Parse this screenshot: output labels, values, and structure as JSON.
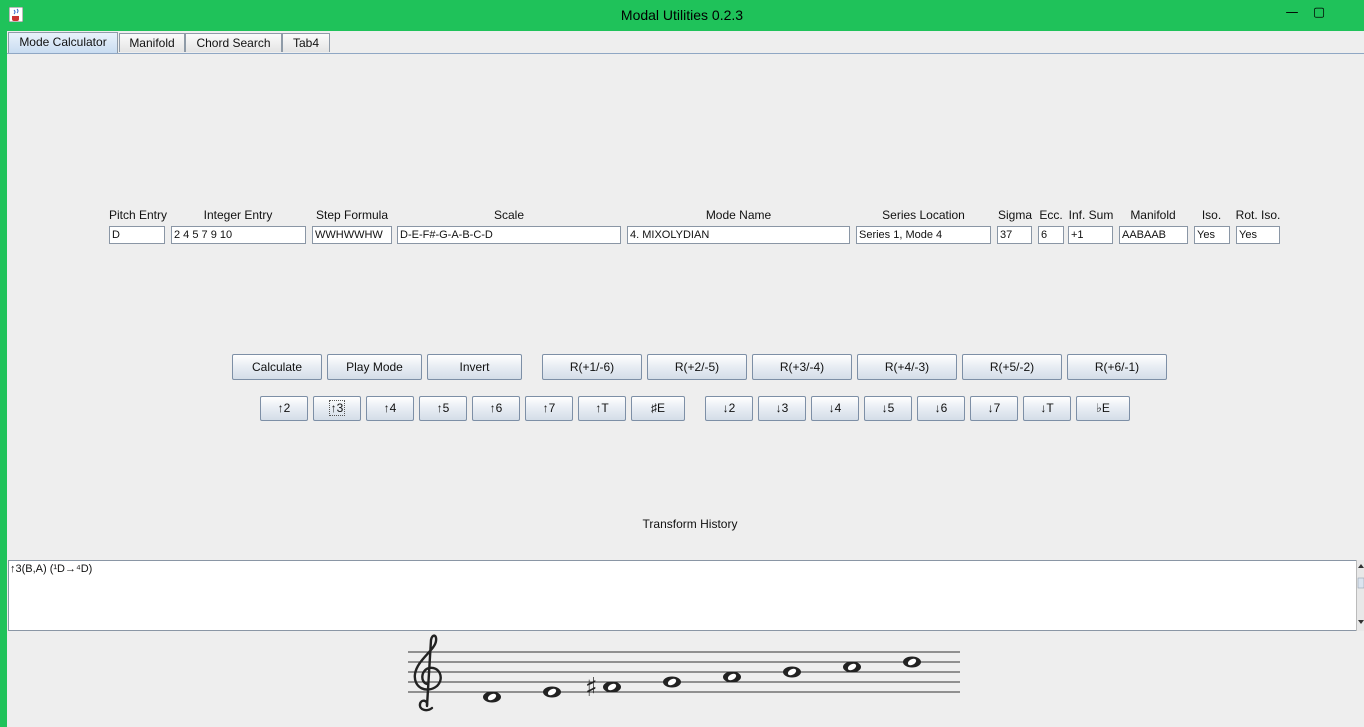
{
  "window": {
    "title": "Modal Utilities 0.2.3",
    "minimize": "—",
    "maximize": "▢"
  },
  "tabs": [
    "Mode Calculator",
    "Manifold",
    "Chord Search",
    "Tab4"
  ],
  "headers": {
    "pitch_entry": "Pitch Entry",
    "integer_entry": "Integer Entry",
    "step_formula": "Step Formula",
    "scale": "Scale",
    "mode_name": "Mode Name",
    "series_location": "Series Location",
    "sigma": "Sigma",
    "ecc": "Ecc.",
    "inf_sum": "Inf. Sum",
    "manifold": "Manifold",
    "iso": "Iso.",
    "rot_iso": "Rot. Iso."
  },
  "values": {
    "pitch_entry": "D",
    "integer_entry": "2 4 5 7 9 10",
    "step_formula": "WWHWWHW",
    "scale": "D-E-F#-G-A-B-C-D",
    "mode_name": "4. MIXOLYDIAN",
    "series_location": "Series 1, Mode 4",
    "sigma": "37",
    "ecc": "6",
    "inf_sum": "+1",
    "manifold": "AABAAB",
    "iso": "Yes",
    "rot_iso": "Yes"
  },
  "buttons_row1": [
    "Calculate",
    "Play Mode",
    "Invert",
    "R(+1/-6)",
    "R(+2/-5)",
    "R(+3/-4)",
    "R(+4/-3)",
    "R(+5/-2)",
    "R(+6/-1)"
  ],
  "buttons_up": [
    "↑2",
    "↑3",
    "↑4",
    "↑5",
    "↑6",
    "↑7",
    "↑T",
    "♯E"
  ],
  "buttons_down": [
    "↓2",
    "↓3",
    "↓4",
    "↓5",
    "↓6",
    "↓7",
    "↓T",
    "♭E"
  ],
  "history": {
    "label": "Transform History",
    "entry": "↑3(B,A) (¹D→⁴D)"
  },
  "notation": {
    "clef_icon": "treble-clef-icon",
    "sharp_glyph": "♯"
  }
}
